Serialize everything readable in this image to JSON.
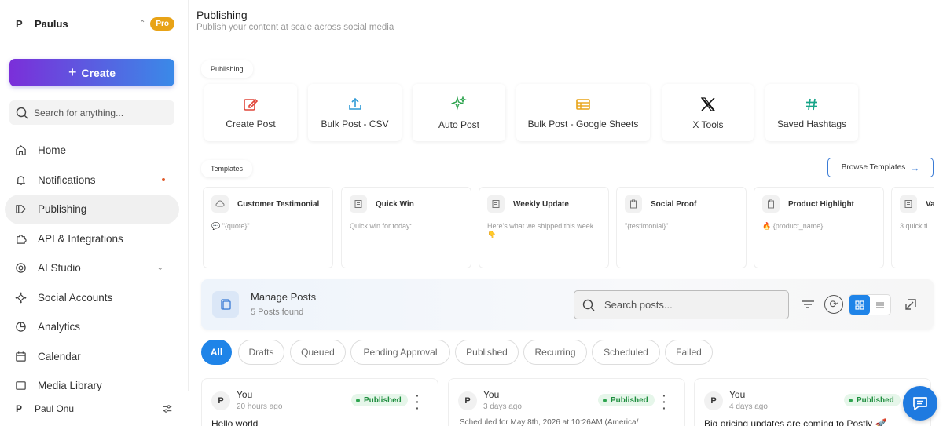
{
  "workspace": {
    "initial": "P",
    "name": "Paulus",
    "plan_badge": "Pro"
  },
  "create_label": "Create",
  "search_placeholder": "Search for anything...",
  "nav": [
    {
      "label": "Home",
      "icon": "home-icon"
    },
    {
      "label": "Notifications",
      "icon": "bell-icon"
    },
    {
      "label": "Publishing",
      "icon": "publishing-icon",
      "active": true
    },
    {
      "label": "API & Integrations",
      "icon": "puzzle-icon"
    },
    {
      "label": "AI Studio",
      "icon": "ai-icon"
    },
    {
      "label": "Social Accounts",
      "icon": "network-icon"
    },
    {
      "label": "Analytics",
      "icon": "chart-icon"
    },
    {
      "label": "Calendar",
      "icon": "calendar-icon"
    },
    {
      "label": "Media Library",
      "icon": "media-icon"
    }
  ],
  "user": {
    "initial": "P",
    "name": "Paul Onu"
  },
  "header": {
    "title": "Publishing",
    "subtitle": "Publish your content at scale across social media"
  },
  "publishing_section_label": "Publishing",
  "tools": [
    {
      "label": "Create Post",
      "icon": "edit-icon",
      "color": "#e0463a"
    },
    {
      "label": "Bulk Post - CSV",
      "icon": "upload-icon",
      "color": "#2f9ad6"
    },
    {
      "label": "Auto Post",
      "icon": "sparkle-icon",
      "color": "#2ea44f"
    },
    {
      "label": "Bulk Post - Google Sheets",
      "icon": "sheet-icon",
      "color": "#e8a317"
    },
    {
      "label": "X Tools",
      "icon": "x-logo-icon",
      "color": "#111111"
    },
    {
      "label": "Saved Hashtags",
      "icon": "hashtag-icon",
      "color": "#17a589"
    }
  ],
  "templates_section_label": "Templates",
  "browse_templates_label": "Browse Templates",
  "templates": [
    {
      "title": "Customer Testimonial",
      "body": "💬 \"{quote}\""
    },
    {
      "title": "Quick Win",
      "body": "Quick win for today:"
    },
    {
      "title": "Weekly Update",
      "body": "Here's what we shipped this week 👇"
    },
    {
      "title": "Social Proof",
      "body": "\"{testimonial}\""
    },
    {
      "title": "Product Highlight",
      "body": "🔥 {product_name}"
    },
    {
      "title": "Va",
      "body": "3 quick ti"
    }
  ],
  "manage": {
    "title": "Manage Posts",
    "count_text": "5 Posts found",
    "search_placeholder": "Search posts..."
  },
  "filter_tabs": [
    "All",
    "Drafts",
    "Queued",
    "Pending Approval",
    "Published",
    "Recurring",
    "Scheduled",
    "Failed"
  ],
  "posts": [
    {
      "initial": "P",
      "author": "You",
      "time": "20 hours ago",
      "status": "Published",
      "body": "Hello world"
    },
    {
      "initial": "P",
      "author": "You",
      "time": "3 days ago",
      "status": "Published",
      "body": "Scheduled for May 8th, 2026 at 10:26AM (America/"
    },
    {
      "initial": "P",
      "author": "You",
      "time": "4 days ago",
      "status": "Published",
      "body": "Big pricing updates are coming to Postly 🚀"
    }
  ],
  "colors": {
    "accent": "#1f84e8",
    "published": "#2ea44f",
    "notification_dot": "#e05a2b",
    "pro": "#e8a317"
  }
}
